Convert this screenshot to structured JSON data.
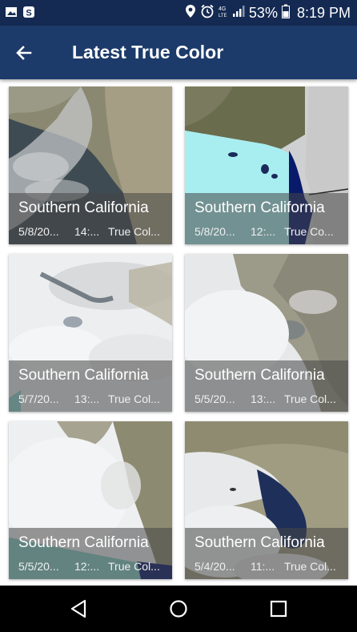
{
  "status_bar": {
    "battery_percent": "53%",
    "time": "8:19 PM",
    "icons": [
      "gallery-icon",
      "shazam-icon",
      "location-icon",
      "alarm-icon",
      "lte-icon",
      "signal-icon",
      "battery-icon"
    ]
  },
  "app_bar": {
    "title": "Latest True Color",
    "back_icon": "arrow-left-icon"
  },
  "cards": [
    {
      "title": "Southern California",
      "date": "5/8/20...",
      "time": "14:...",
      "type": "True Col..."
    },
    {
      "title": "Southern California",
      "date": "5/8/20...",
      "time": "12:...",
      "type": "True Co..."
    },
    {
      "title": "Southern California",
      "date": "5/7/20...",
      "time": "13:...",
      "type": "True Col..."
    },
    {
      "title": "Southern California",
      "date": "5/5/20...",
      "time": "13:...",
      "type": "True Col..."
    },
    {
      "title": "Southern California",
      "date": "5/5/20...",
      "time": "12:...",
      "type": "True Col..."
    },
    {
      "title": "Southern California",
      "date": "5/4/20...",
      "time": "11:...",
      "type": "True Col..."
    }
  ],
  "nav_bar": {
    "icons": [
      "back-triangle-icon",
      "home-circle-icon",
      "recents-square-icon"
    ]
  }
}
